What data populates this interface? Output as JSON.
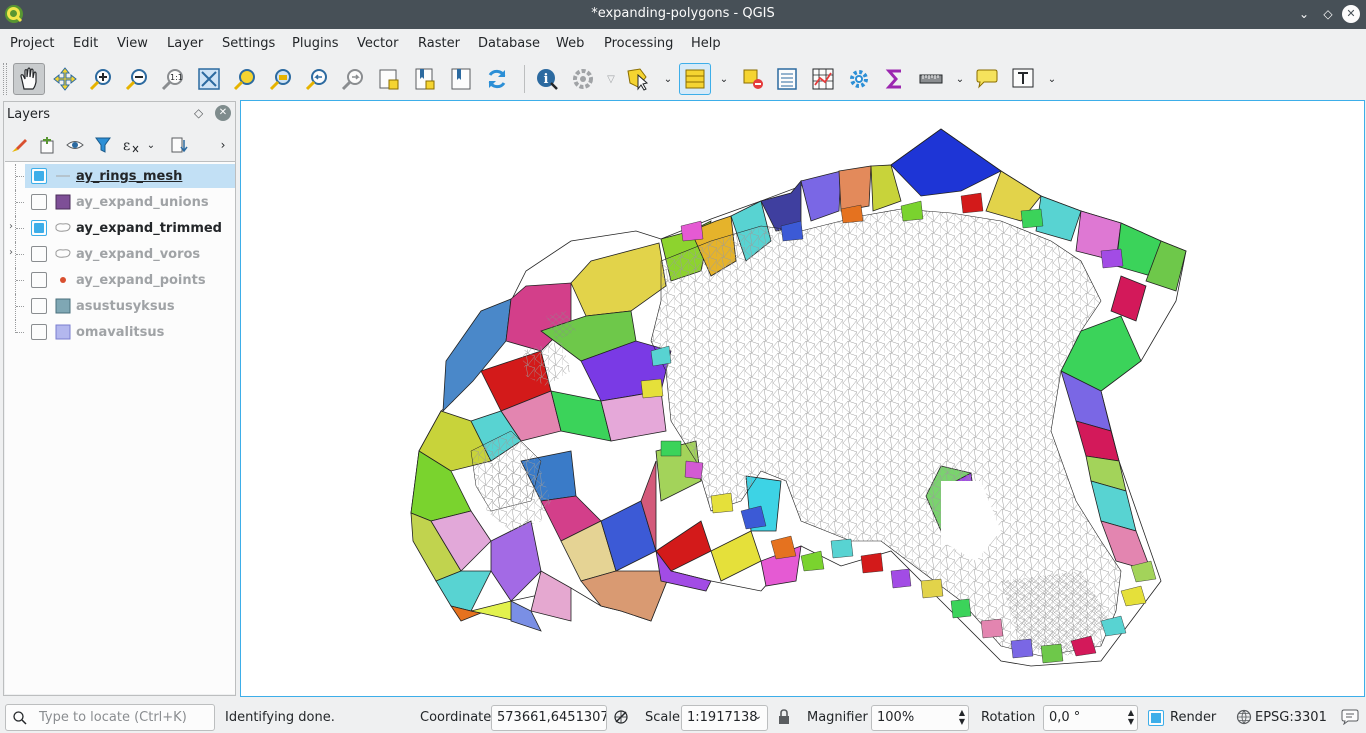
{
  "window": {
    "title": "*expanding-polygons - QGIS",
    "controls": [
      "minimize",
      "maximize",
      "close"
    ]
  },
  "menubar": {
    "items": [
      "Project",
      "Edit",
      "View",
      "Layer",
      "Settings",
      "Plugins",
      "Vector",
      "Raster",
      "Database",
      "Web",
      "Processing",
      "Help"
    ]
  },
  "toolbar": {
    "buttons": [
      {
        "name": "pan-map",
        "icon": "hand-icon",
        "active": true
      },
      {
        "name": "pan-to-selection",
        "icon": "pan-selection-icon"
      },
      {
        "name": "zoom-in",
        "icon": "zoom-in-icon"
      },
      {
        "name": "zoom-out",
        "icon": "zoom-out-icon"
      },
      {
        "name": "zoom-native",
        "icon": "zoom-native-icon"
      },
      {
        "name": "zoom-full",
        "icon": "zoom-full-icon"
      },
      {
        "name": "zoom-to-selection",
        "icon": "zoom-selection-icon"
      },
      {
        "name": "zoom-to-layer",
        "icon": "zoom-layer-icon"
      },
      {
        "name": "zoom-last",
        "icon": "zoom-last-icon"
      },
      {
        "name": "zoom-next",
        "icon": "zoom-next-icon"
      },
      {
        "name": "new-bookmark",
        "icon": "new-bookmark-icon"
      },
      {
        "name": "show-bookmarks",
        "icon": "show-bookmarks-icon"
      },
      {
        "name": "temporal",
        "icon": "temporal-icon"
      },
      {
        "name": "refresh",
        "icon": "refresh-icon"
      },
      {
        "name": "identify",
        "icon": "identify-icon"
      },
      {
        "name": "run-action",
        "icon": "action-icon"
      },
      {
        "name": "select-features",
        "icon": "select-icon"
      },
      {
        "name": "open-attribute-table",
        "icon": "attribute-table-icon",
        "checked": true
      },
      {
        "name": "deselect",
        "icon": "deselect-icon"
      },
      {
        "name": "field-calculator",
        "icon": "field-calculator-icon"
      },
      {
        "name": "statistical-summary",
        "icon": "statistics-icon"
      },
      {
        "name": "processing-toolbox",
        "icon": "gear-icon"
      },
      {
        "name": "sum",
        "icon": "sigma-icon"
      },
      {
        "name": "measure",
        "icon": "ruler-icon"
      },
      {
        "name": "map-tips",
        "icon": "speech-bubble-icon"
      },
      {
        "name": "text-annotation",
        "icon": "text-annotation-icon"
      }
    ]
  },
  "layers_panel": {
    "title": "Layers",
    "layers": [
      {
        "name": "ay_rings_mesh",
        "checked": true,
        "selected": true,
        "current": true,
        "symbol": "line",
        "symbol_color": "#a8a8a8",
        "expandable": false
      },
      {
        "name": "ay_expand_unions",
        "checked": false,
        "symbol": "fill",
        "symbol_color": "#7e4f97",
        "expandable": false
      },
      {
        "name": "ay_expand_trimmed",
        "checked": true,
        "symbol": "categorized",
        "symbol_color": "#9a9a9a",
        "expandable": true
      },
      {
        "name": "ay_expand_voros",
        "checked": false,
        "symbol": "categorized",
        "symbol_color": "#9a9a9a",
        "expandable": true
      },
      {
        "name": "ay_expand_points",
        "checked": false,
        "symbol": "point",
        "symbol_color": "#d95030",
        "expandable": false
      },
      {
        "name": "asustusyksus",
        "checked": false,
        "symbol": "fill",
        "symbol_color": "#7fa7b4",
        "expandable": false
      },
      {
        "name": "omavalitsus",
        "checked": false,
        "symbol": "fill",
        "symbol_color": "#b3b7ee",
        "expandable": false
      }
    ]
  },
  "statusbar": {
    "locator_placeholder": "Type to locate (Ctrl+K)",
    "message": "Identifying done.",
    "coordinate_label": "Coordinate",
    "coordinate_value": "573661,6451307",
    "scale_label": "Scale",
    "scale_value": "1:1917138",
    "magnifier_label": "Magnifier",
    "magnifier_value": "100%",
    "rotation_label": "Rotation",
    "rotation_value": "0,0 °",
    "render_label": "Render",
    "render_checked": true,
    "crs": "EPSG:3301"
  }
}
